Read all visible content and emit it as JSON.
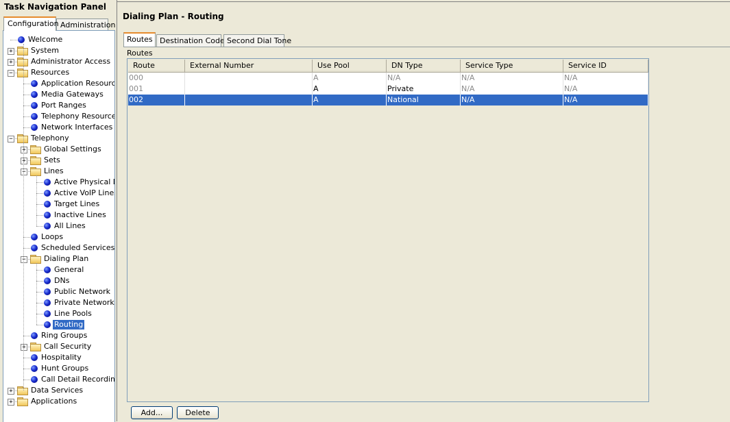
{
  "panel": {
    "title": "Task Navigation Panel",
    "tabs": {
      "configuration": "Configuration",
      "administration": "Administration"
    }
  },
  "tree": [
    {
      "label": "Welcome",
      "kind": "leaf",
      "depth": 0
    },
    {
      "label": "System",
      "kind": "folder",
      "depth": 0,
      "expander": "+"
    },
    {
      "label": "Administrator Access",
      "kind": "folder",
      "depth": 0,
      "expander": "+"
    },
    {
      "label": "Resources",
      "kind": "folder",
      "depth": 0,
      "expander": "-"
    },
    {
      "label": "Application Resources",
      "kind": "leaf",
      "depth": 1
    },
    {
      "label": "Media Gateways",
      "kind": "leaf",
      "depth": 1
    },
    {
      "label": "Port Ranges",
      "kind": "leaf",
      "depth": 1
    },
    {
      "label": "Telephony Resources",
      "kind": "leaf",
      "depth": 1
    },
    {
      "label": "Network Interfaces",
      "kind": "leaf",
      "depth": 1
    },
    {
      "label": "Telephony",
      "kind": "folder",
      "depth": 0,
      "expander": "-"
    },
    {
      "label": "Global Settings",
      "kind": "folder",
      "depth": 1,
      "expander": "+"
    },
    {
      "label": "Sets",
      "kind": "folder",
      "depth": 1,
      "expander": "+"
    },
    {
      "label": "Lines",
      "kind": "folder",
      "depth": 1,
      "expander": "-"
    },
    {
      "label": "Active Physical Lines",
      "kind": "leaf",
      "depth": 2
    },
    {
      "label": "Active VoIP Lines",
      "kind": "leaf",
      "depth": 2
    },
    {
      "label": "Target Lines",
      "kind": "leaf",
      "depth": 2
    },
    {
      "label": "Inactive Lines",
      "kind": "leaf",
      "depth": 2
    },
    {
      "label": "All Lines",
      "kind": "leaf",
      "depth": 2
    },
    {
      "label": "Loops",
      "kind": "leaf",
      "depth": 1
    },
    {
      "label": "Scheduled Services",
      "kind": "leaf",
      "depth": 1
    },
    {
      "label": "Dialing Plan",
      "kind": "folder",
      "depth": 1,
      "expander": "-"
    },
    {
      "label": "General",
      "kind": "leaf",
      "depth": 2
    },
    {
      "label": "DNs",
      "kind": "leaf",
      "depth": 2
    },
    {
      "label": "Public Network",
      "kind": "leaf",
      "depth": 2
    },
    {
      "label": "Private Network",
      "kind": "leaf",
      "depth": 2
    },
    {
      "label": "Line Pools",
      "kind": "leaf",
      "depth": 2
    },
    {
      "label": "Routing",
      "kind": "leaf",
      "depth": 2,
      "selected": true
    },
    {
      "label": "Ring Groups",
      "kind": "leaf",
      "depth": 1
    },
    {
      "label": "Call Security",
      "kind": "folder",
      "depth": 1,
      "expander": "+"
    },
    {
      "label": "Hospitality",
      "kind": "leaf",
      "depth": 1
    },
    {
      "label": "Hunt Groups",
      "kind": "leaf",
      "depth": 1
    },
    {
      "label": "Call Detail Recording",
      "kind": "leaf",
      "depth": 1
    },
    {
      "label": "Data Services",
      "kind": "folder",
      "depth": 0,
      "expander": "+"
    },
    {
      "label": "Applications",
      "kind": "folder",
      "depth": 0,
      "expander": "+"
    }
  ],
  "main": {
    "title": "Dialing Plan - Routing",
    "tabs": [
      "Routes",
      "Destination Codes",
      "Second Dial Tone"
    ],
    "section_label": "Routes",
    "columns": [
      "Route",
      "External Number",
      "Use Pool",
      "DN Type",
      "Service Type",
      "Service ID"
    ],
    "rows": [
      {
        "route": "000",
        "external_number": "",
        "use_pool": "A",
        "dn_type": "N/A",
        "service_type": "N/A",
        "service_id": "N/A",
        "selected": false,
        "pool_dark": false
      },
      {
        "route": "001",
        "external_number": "",
        "use_pool": "A",
        "dn_type": "Private",
        "service_type": "N/A",
        "service_id": "N/A",
        "selected": false,
        "pool_dark": true
      },
      {
        "route": "002",
        "external_number": "",
        "use_pool": "A",
        "dn_type": "National",
        "service_type": "N/A",
        "service_id": "N/A",
        "selected": true,
        "pool_dark": true
      }
    ],
    "buttons": {
      "add": "Add...",
      "delete": "Delete"
    }
  },
  "colors": {
    "selection": "#316ac5",
    "tab_accent": "#e68b2c",
    "window_bg": "#ece9d8"
  }
}
